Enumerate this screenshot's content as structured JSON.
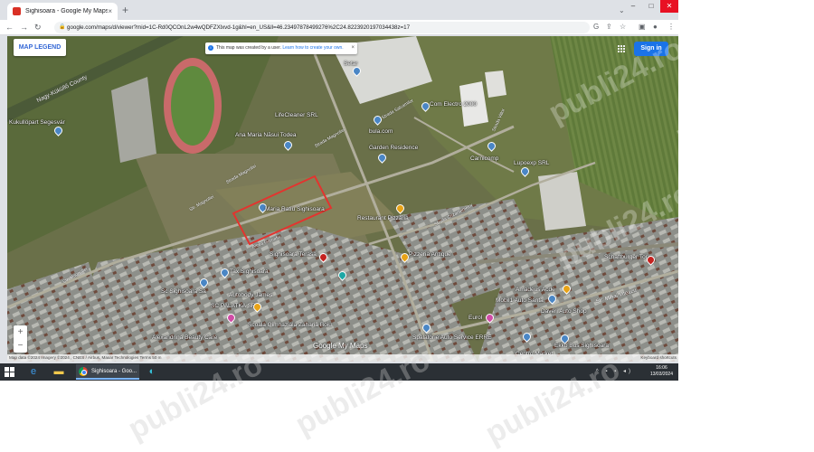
{
  "browser": {
    "tab_title": "Sighisoara - Google My Maps",
    "tab_close": "×",
    "new_tab": "+",
    "url": "google.com/maps/d/viewer?mid=1C-Rd0QCOnL2w4wQDFZXlxvd-1g&hl=en_US&ll=46.2349787849927​6%2C24.8223920197034438z=17",
    "window_min": "–",
    "window_max": "□",
    "window_close": "✕",
    "tab_search": "⌄"
  },
  "map": {
    "legend_label": "MAP LEGEND",
    "notice_text": "This map was created by a user.",
    "notice_link": "Learn how to create your own.",
    "notice_close": "×",
    "signin_label": "Sign in",
    "zoom_in": "+",
    "zoom_out": "−",
    "brand": "Google My Maps",
    "attribution": "Map data ©2024 Imagery ©2024 , CNES / Airbus, Maxar Technologies    Terms    50 m",
    "keyboard_shortcuts": "Keyboard shortcuts",
    "places": [
      {
        "name": "Nagy-Küküllő County",
        "kind": "road"
      },
      {
        "name": "Kukullöpart Segesvár"
      },
      {
        "name": "Setar"
      },
      {
        "name": "LifeCleaner SRL"
      },
      {
        "name": "Ana Maria Năsui Todea"
      },
      {
        "name": "bula.com"
      },
      {
        "name": "Garden Residence"
      },
      {
        "name": "Com Electro 2000"
      },
      {
        "name": "Carnicomp"
      },
      {
        "name": "Lupoexp SRL"
      },
      {
        "name": "Maria Ratiu Sighisoara"
      },
      {
        "name": "Restaurant Pizzaria"
      },
      {
        "name": "Pizzeria Antique"
      },
      {
        "name": "Sighisoara Terasa"
      },
      {
        "name": "Tax Sighisoara"
      },
      {
        "name": "Autobody James"
      },
      {
        "name": "SC PALATKA SRL"
      },
      {
        "name": "Scoala Gimnaziala Zaharia Boiu"
      },
      {
        "name": "Alexandrina Beauty Care"
      },
      {
        "name": "Sc Sighisoara Sa"
      },
      {
        "name": "Spalatorie Auto Service ERRE"
      },
      {
        "name": "Eurol"
      },
      {
        "name": "Mobil1 Auto Santa"
      },
      {
        "name": "Daveri Auto Shop"
      },
      {
        "name": "Amadeus Acde"
      },
      {
        "name": "Schaftburger Tor"
      },
      {
        "name": "Centro Market"
      },
      {
        "name": "Ekko Bus Sighisoara"
      }
    ],
    "roads": [
      "Strada Magnoliei",
      "Str. Magnoliei",
      "Strada Salcamilor",
      "Strada Crizantemelor",
      "Strada Viilor",
      "Str. Mihai Viteazu",
      "Strada Garofitei",
      "Aleea Garoafei"
    ]
  },
  "taskbar": {
    "chrome_label": "Sighisoara - Goo...",
    "time": "16:06",
    "date": "13/03/2024"
  },
  "watermark": "publi24.ro",
  "colors": {
    "accent": "#1a73e8",
    "highlight": "#e3342f",
    "taskbar": "#2b3035"
  }
}
